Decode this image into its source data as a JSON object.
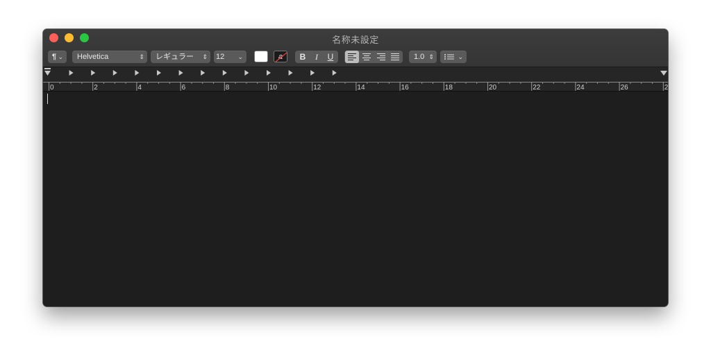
{
  "window": {
    "title": "名称未設定",
    "traffic_lights": {
      "close": "#ff5f57",
      "minimize": "#febc2e",
      "maximize": "#28c840"
    }
  },
  "toolbar": {
    "paragraph_style": {
      "icon": "pilcrow-icon",
      "label": "¶"
    },
    "font_family": "Helvetica",
    "font_style": "レギュラー",
    "font_size": "12",
    "text_color": "#ffffff",
    "highlight_color_label": "a",
    "bold_label": "B",
    "italic_label": "I",
    "underline_label": "U",
    "alignment": {
      "selected": "left",
      "options": [
        "left",
        "center",
        "right",
        "justify"
      ]
    },
    "line_spacing": "1.0",
    "list_style": {
      "icon": "list-bullets-icon"
    }
  },
  "ruler": {
    "labels": [
      "0",
      "2",
      "4",
      "6",
      "8",
      "10",
      "12",
      "14",
      "16",
      "18",
      "20",
      "22",
      "24",
      "26",
      "2"
    ],
    "tab_stops_count": 13,
    "units": "cm"
  },
  "document": {
    "text": ""
  }
}
